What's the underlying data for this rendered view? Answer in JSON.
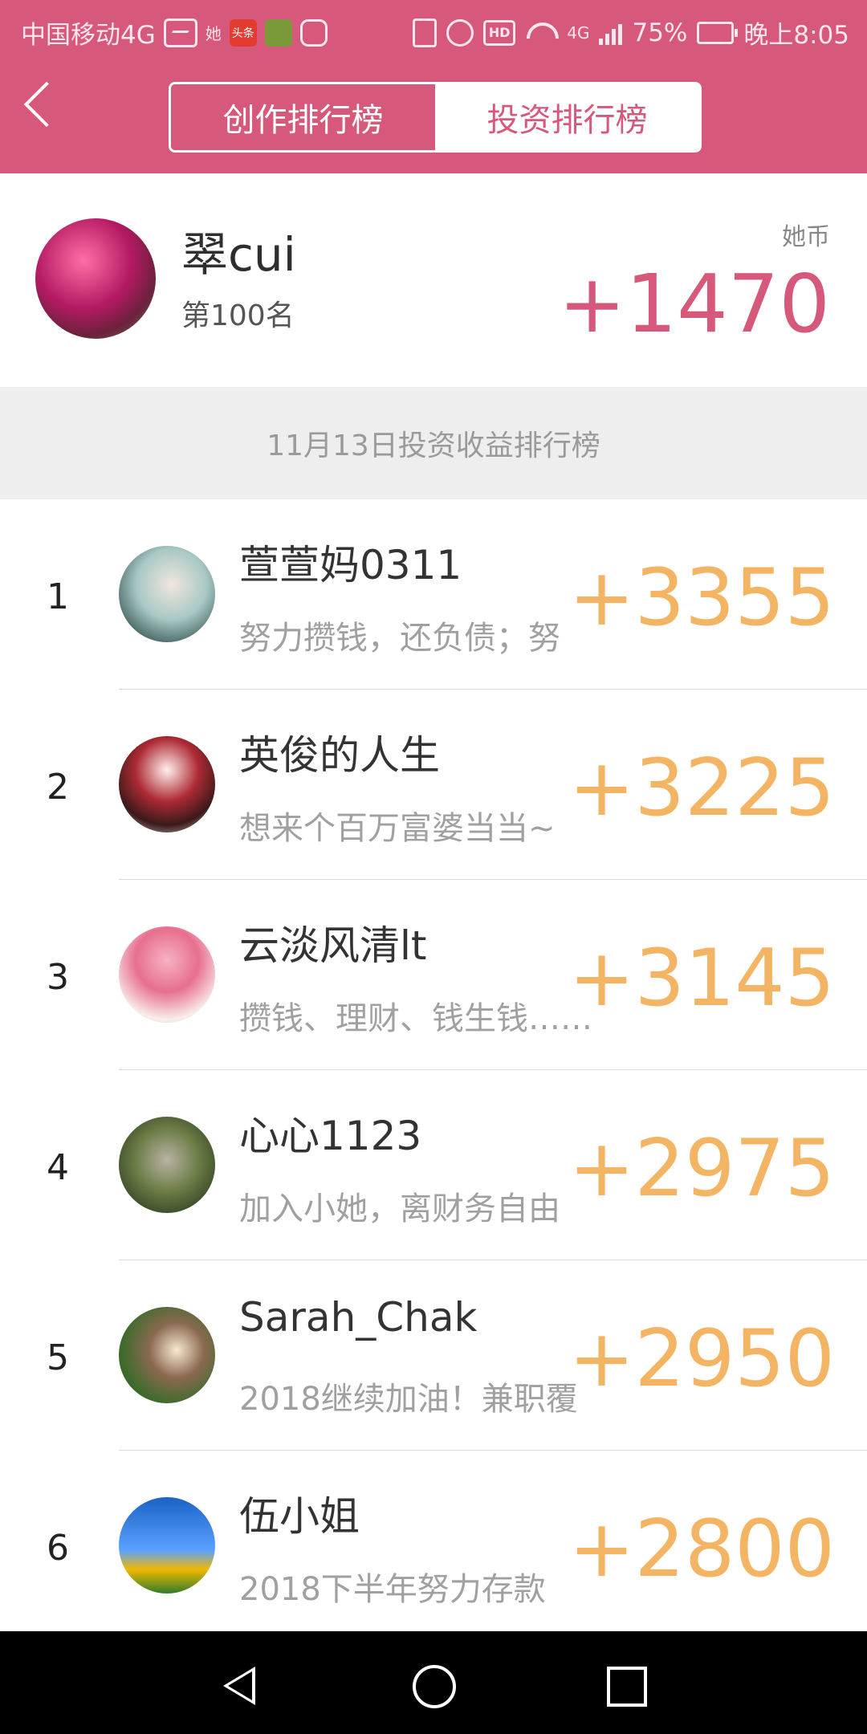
{
  "status_bar": {
    "carrier": "中国移动4G",
    "app1": "她",
    "app2": "头条",
    "app3": "",
    "network": "4G",
    "battery": "75%",
    "time": "晚上8:05"
  },
  "nav": {
    "back_icon": "back-chevron-icon",
    "tabs": [
      {
        "label": "创作排行榜",
        "active": false
      },
      {
        "label": "投资排行榜",
        "active": true
      }
    ]
  },
  "me": {
    "name": "翠cui",
    "rank": "第100名",
    "coin_label": "她币",
    "coin_value": "+1470"
  },
  "banner": {
    "text": "11月13日投资收益排行榜"
  },
  "leaderboard": [
    {
      "rank": "1",
      "name": "萱萱妈0311",
      "bio": "努力攒钱，还负债；努",
      "score": "+3355"
    },
    {
      "rank": "2",
      "name": "英俊的人生",
      "bio": "想来个百万富婆当当~",
      "score": "+3225"
    },
    {
      "rank": "3",
      "name": "云淡风清lt",
      "bio": "攒钱、理财、钱生钱……",
      "score": "+3145"
    },
    {
      "rank": "4",
      "name": "心心1123",
      "bio": "加入小她，离财务自由",
      "score": "+2975"
    },
    {
      "rank": "5",
      "name": "Sarah_Chak",
      "bio": "2018继续加油！兼职覆",
      "score": "+2950"
    },
    {
      "rank": "6",
      "name": "伍小姐",
      "bio": "2018下半年努力存款",
      "score": "+2800"
    }
  ],
  "colors": {
    "brand": "#d6587a",
    "score": "#f3b564",
    "banner_bg": "#eeeeee"
  }
}
